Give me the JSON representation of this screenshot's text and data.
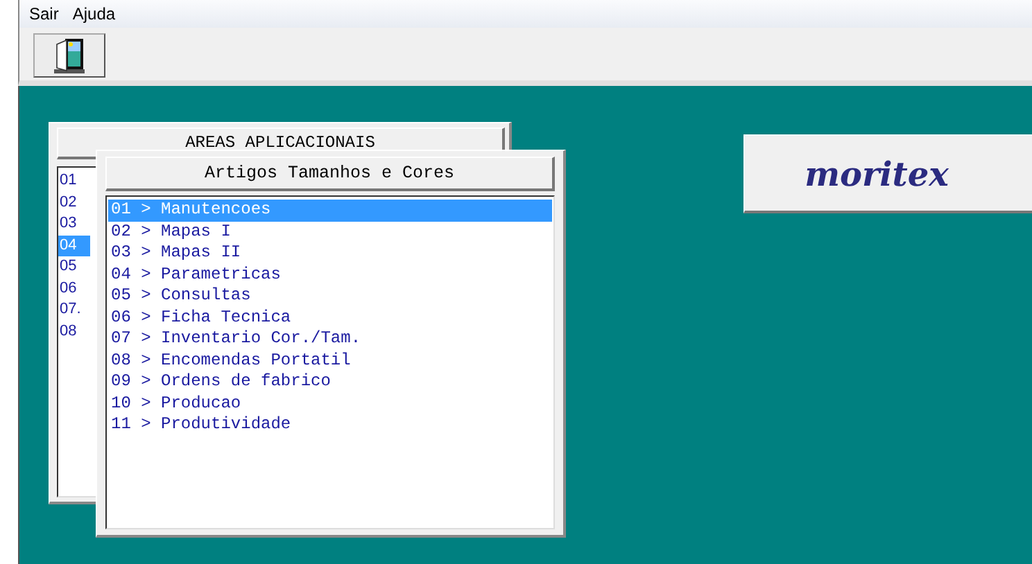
{
  "menu": [
    "Sair",
    "Ajuda"
  ],
  "back_window": {
    "title": "AREAS APLICACIONAIS",
    "items": [
      {
        "label": "01",
        "selected": false
      },
      {
        "label": "02",
        "selected": false
      },
      {
        "label": "03",
        "selected": false
      },
      {
        "label": "04",
        "selected": true
      },
      {
        "label": "05",
        "selected": false
      },
      {
        "label": "06",
        "selected": false
      },
      {
        "label": "07.",
        "selected": false
      },
      {
        "label": "08",
        "selected": false
      }
    ]
  },
  "front_window": {
    "title": "Artigos Tamanhos e Cores",
    "items": [
      {
        "label": "01 > Manutencoes",
        "selected": true
      },
      {
        "label": "02 > Mapas I",
        "selected": false
      },
      {
        "label": "03 > Mapas II",
        "selected": false
      },
      {
        "label": "04 > Parametricas",
        "selected": false
      },
      {
        "label": "05 > Consultas",
        "selected": false
      },
      {
        "label": "06 > Ficha Tecnica",
        "selected": false
      },
      {
        "label": "07 > Inventario Cor./Tam.",
        "selected": false
      },
      {
        "label": "08 > Encomendas Portatil",
        "selected": false
      },
      {
        "label": "09 > Ordens de fabrico",
        "selected": false
      },
      {
        "label": "10 > Producao",
        "selected": false
      },
      {
        "label": "11 > Produtividade",
        "selected": false
      }
    ]
  },
  "logo": "moritex"
}
